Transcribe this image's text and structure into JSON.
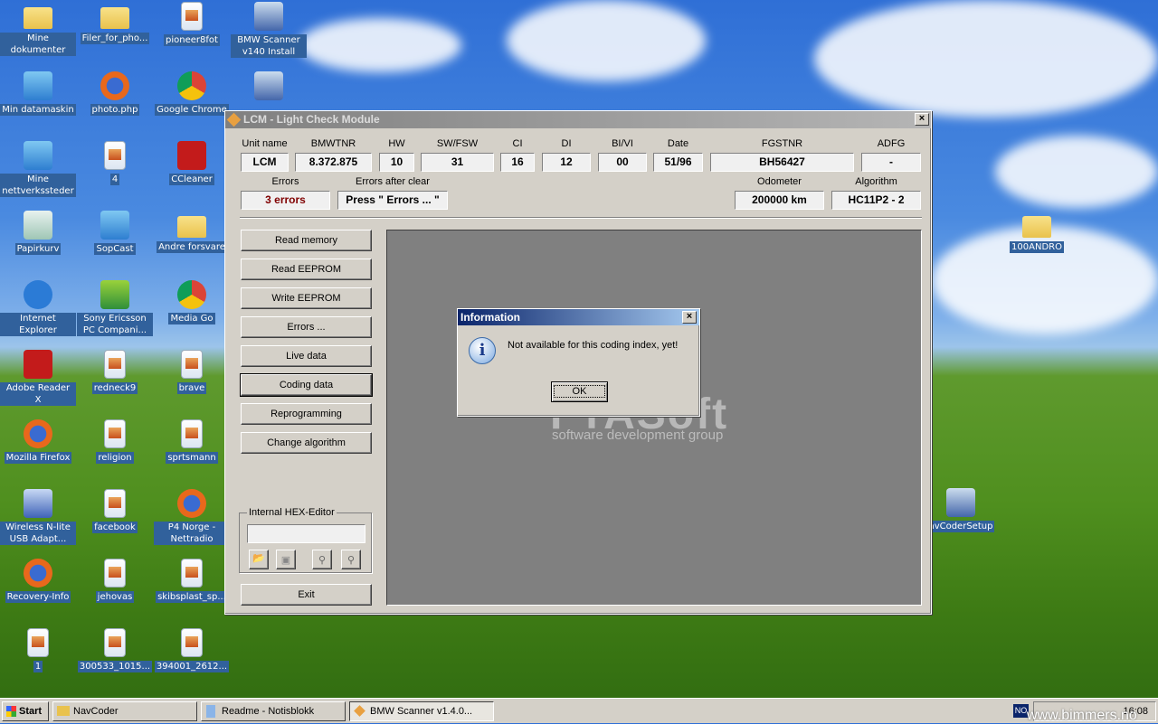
{
  "desktop": {
    "icons": [
      {
        "label": "Mine dokumenter",
        "icon": "folder"
      },
      {
        "label": "Filer_for_pho...",
        "icon": "folder"
      },
      {
        "label": "pioneer8fot",
        "icon": "file"
      },
      {
        "label": "BMW Scanner v140 Install",
        "icon": "setup"
      },
      {
        "label": "Min datamaskin",
        "icon": "pc"
      },
      {
        "label": "photo.php",
        "icon": "ff"
      },
      {
        "label": "Google Chrome",
        "icon": "chrome"
      },
      {
        "label": "",
        "icon": "setup"
      },
      {
        "label": "Mine nettverkssteder",
        "icon": "pc"
      },
      {
        "label": "4",
        "icon": "file"
      },
      {
        "label": "CCleaner",
        "icon": "red"
      },
      {
        "label": "Papirkurv",
        "icon": "bin"
      },
      {
        "label": "SopCast",
        "icon": "pc"
      },
      {
        "label": "Andre forsvare",
        "icon": "folder"
      },
      {
        "label": "Internet Explorer",
        "icon": "ie"
      },
      {
        "label": "Sony Ericsson PC Compani...",
        "icon": "green"
      },
      {
        "label": "Media Go",
        "icon": "chrome"
      },
      {
        "label": "Adobe Reader X",
        "icon": "red"
      },
      {
        "label": "redneck9",
        "icon": "file"
      },
      {
        "label": "brave",
        "icon": "file"
      },
      {
        "label": "Mozilla Firefox",
        "icon": "ff"
      },
      {
        "label": "religion",
        "icon": "file"
      },
      {
        "label": "sprtsmann",
        "icon": "file"
      },
      {
        "label": "Wireless N-lite USB Adapt...",
        "icon": "z"
      },
      {
        "label": "facebook",
        "icon": "file"
      },
      {
        "label": "P4 Norge - Nettradio",
        "icon": "ff"
      },
      {
        "label": "Recovery-Info",
        "icon": "ff"
      },
      {
        "label": "jehovas",
        "icon": "file"
      },
      {
        "label": "skibsplast_sp...",
        "icon": "file"
      },
      {
        "label": "1",
        "icon": "file"
      },
      {
        "label": "300533_1015...",
        "icon": "file"
      },
      {
        "label": "394001_2612...",
        "icon": "file"
      },
      {
        "label": "100ANDRO",
        "icon": "folder"
      },
      {
        "label": "avCoderSetup",
        "icon": "setup"
      }
    ]
  },
  "window": {
    "title": "LCM - Light Check Module",
    "fields": [
      {
        "label": "Unit name",
        "value": "LCM"
      },
      {
        "label": "BMWTNR",
        "value": "8.372.875"
      },
      {
        "label": "HW",
        "value": "10"
      },
      {
        "label": "SW/FSW",
        "value": "31"
      },
      {
        "label": "CI",
        "value": "16"
      },
      {
        "label": "DI",
        "value": "12"
      },
      {
        "label": "BI/VI",
        "value": "00"
      },
      {
        "label": "Date",
        "value": "51/96"
      },
      {
        "label": "FGSTNR",
        "value": "BH56427"
      },
      {
        "label": "ADFG",
        "value": "-"
      }
    ],
    "fields2": [
      {
        "label": "Errors",
        "value": "3 errors"
      },
      {
        "label": "Errors after clear",
        "value": "Press \" Errors ... \""
      },
      {
        "label": "Odometer",
        "value": "200000 km"
      },
      {
        "label": "Algorithm",
        "value": "HC11P2 - 2"
      }
    ],
    "error_color": "#800000",
    "buttons": [
      "Read memory",
      "Read EEPROM",
      "Write EEPROM",
      "Errors ...",
      "Live data",
      "Coding data",
      "Reprogramming",
      "Change algorithm"
    ],
    "hex_editor_label": "Internal HEX-Editor",
    "hex_input": "",
    "exit": "Exit",
    "logo_top": "FTASoft",
    "logo_bottom": "software development group"
  },
  "dialog": {
    "title": "Information",
    "message": "Not available for this coding index, yet!",
    "ok": "OK"
  },
  "taskbar": {
    "start": "Start",
    "items": [
      "NavCoder",
      "Readme - Notisblokk",
      "BMW Scanner v1.4.0..."
    ],
    "lang": "NO",
    "clock": "16:08",
    "watermark": "www.bimmers.no"
  }
}
